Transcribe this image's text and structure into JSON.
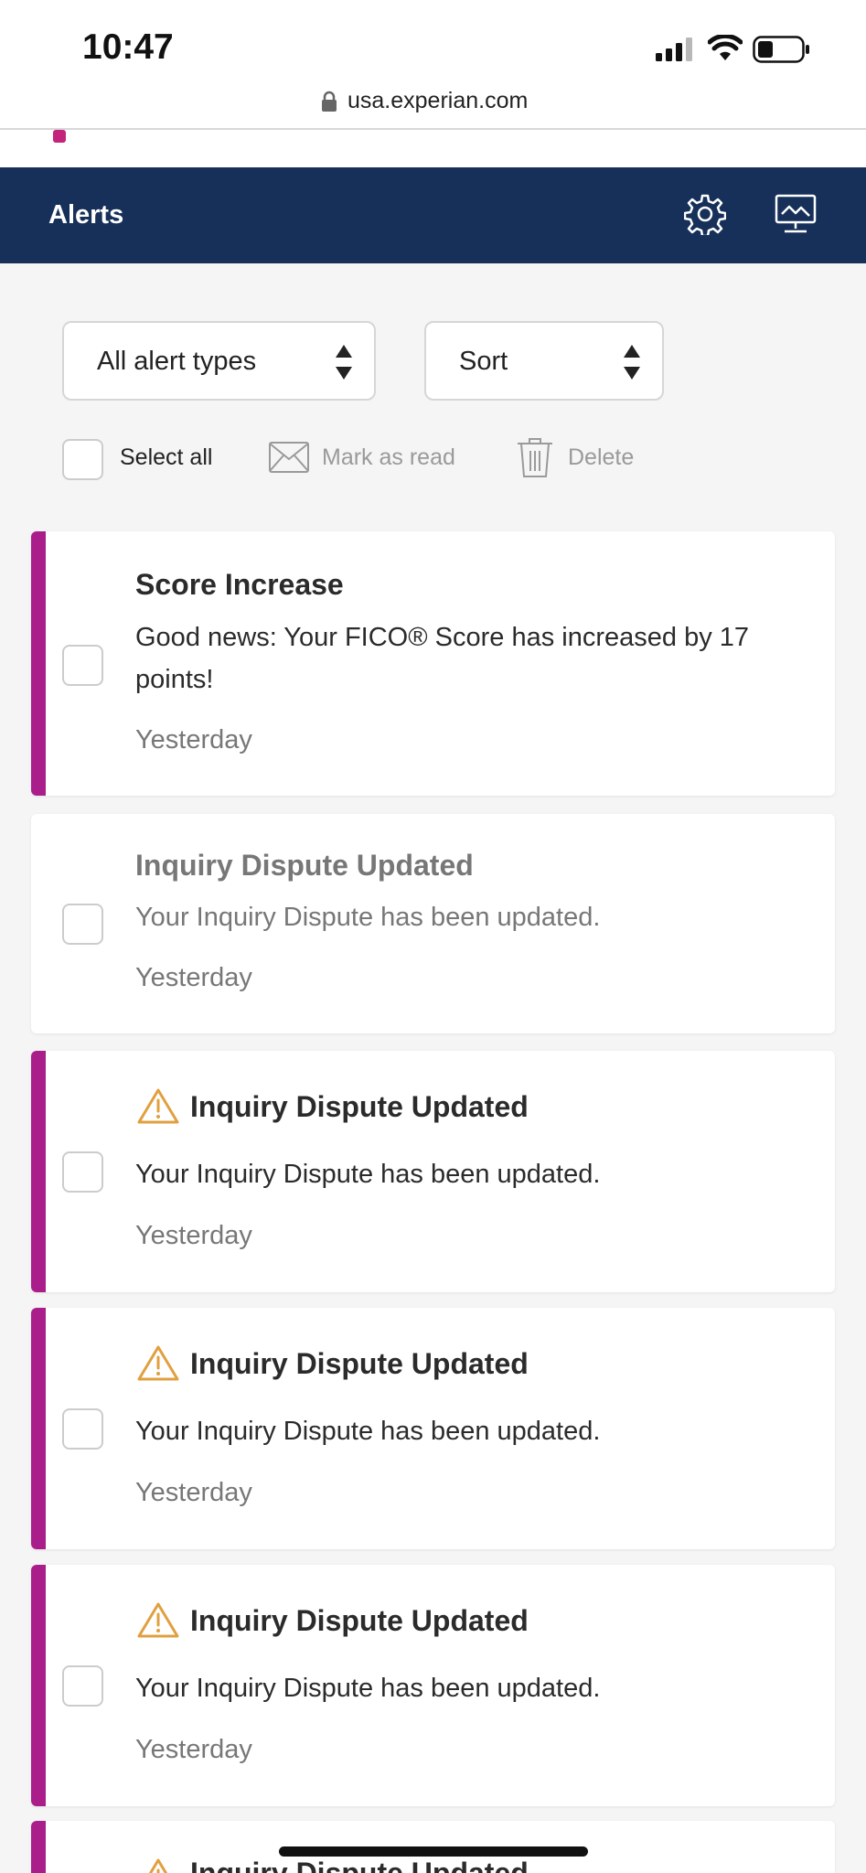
{
  "status_bar": {
    "time": "10:47"
  },
  "browser": {
    "url": "usa.experian.com"
  },
  "header": {
    "title": "Alerts",
    "icons": [
      "gear-icon",
      "monitor-icon"
    ]
  },
  "filters": {
    "type_select": "All alert types",
    "sort_select": "Sort"
  },
  "toolbar": {
    "select_all": "Select all",
    "mark_as_read": "Mark as read",
    "delete": "Delete"
  },
  "colors": {
    "header_bg": "#16305a",
    "unread_accent": "#aa1e8c",
    "warning": "#e0a040"
  },
  "alerts": [
    {
      "title": "Score Increase",
      "body": "Good news: Your FICO® Score has increased by 17 points!",
      "date": "Yesterday",
      "unread": true,
      "warning_icon": false
    },
    {
      "title": "Inquiry Dispute Updated",
      "body": "Your Inquiry Dispute has been updated.",
      "date": "Yesterday",
      "unread": false,
      "warning_icon": false
    },
    {
      "title": "Inquiry Dispute Updated",
      "body": "Your Inquiry Dispute has been updated.",
      "date": "Yesterday",
      "unread": true,
      "warning_icon": true
    },
    {
      "title": "Inquiry Dispute Updated",
      "body": "Your Inquiry Dispute has been updated.",
      "date": "Yesterday",
      "unread": true,
      "warning_icon": true
    },
    {
      "title": "Inquiry Dispute Updated",
      "body": "Your Inquiry Dispute has been updated.",
      "date": "Yesterday",
      "unread": true,
      "warning_icon": true
    },
    {
      "title": "Inquiry Dispute Updated",
      "unread": true,
      "warning_icon": true
    }
  ]
}
